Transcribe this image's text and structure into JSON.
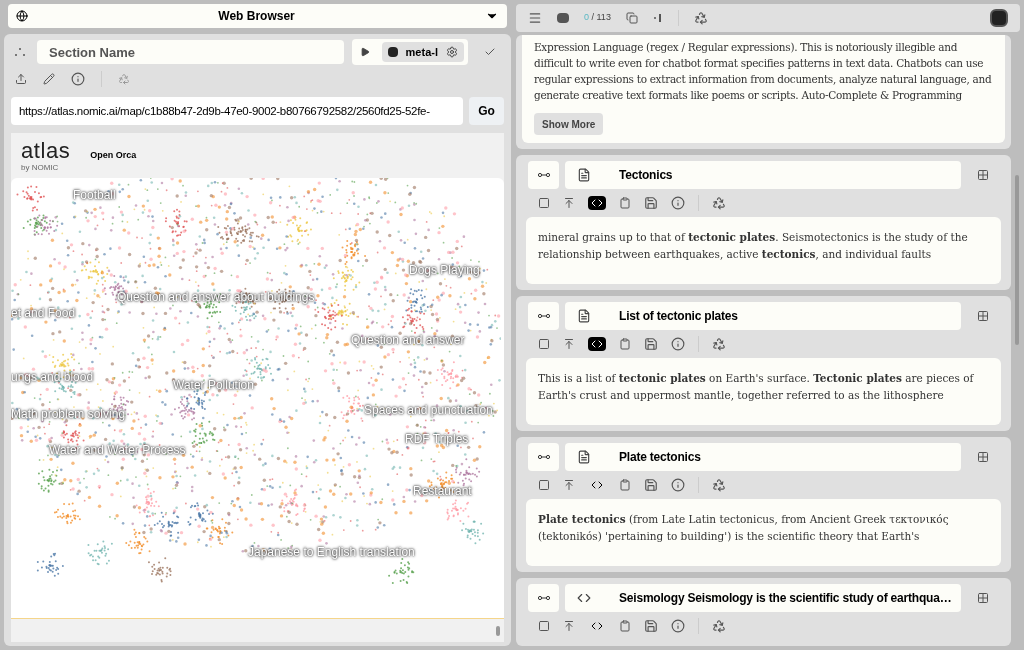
{
  "left_panel": {
    "selector": {
      "title": "Web Browser"
    },
    "section": {
      "placeholder": "Section Name"
    },
    "model": {
      "name": "meta-l"
    },
    "url": {
      "value": "https://atlas.nomic.ai/map/c1b88b47-2d9b-47e0-9002-b80766792582/2560fd25-52fe-"
    },
    "go_button": "Go",
    "atlas": {
      "logo": "atlas",
      "byline": "by NOMIC",
      "project": "Open Orca",
      "labels": [
        "Football",
        "Dogs Playing",
        "Question and answer about buildings",
        "et and Food",
        "Question and answer",
        "ungs and blood",
        "Water Pollution",
        "Math problem solving",
        "Spaces and punctuation",
        "RDF Triples",
        "Water and Water Process",
        "Restaurant",
        "Japanese to English translation"
      ]
    }
  },
  "right_panel": {
    "counter": {
      "current": "0",
      "total": "/ 113"
    },
    "intro_card": {
      "text": "Expression Language (regex / Regular expressions). This is notoriously illegible and difficult to write even for chatbot format specifies patterns in text data. Chatbots can use regular expressions to extract information from documents, analyze natural language, and generate creative text formats like poems or scripts. Auto-Complete & Programming",
      "button": "Show More"
    },
    "cards": [
      {
        "title": "Tectonics",
        "kind": "document",
        "code_view": true,
        "text": "mineral grains up to that of **tectonic plates**. Seismotectonics is the study of the relationship between earthquakes, active **tectonics**, and individual faults"
      },
      {
        "title": "List of tectonic plates",
        "kind": "document",
        "code_view": true,
        "text": "This is a list of **tectonic plates** on Earth's surface. **Tectonic plates** are pieces of Earth's crust and uppermost mantle, together referred to as the lithosphere"
      },
      {
        "title": "Plate tectonics",
        "kind": "document",
        "code_view": false,
        "text": "**Plate tectonics** (from Late Latin tectonicus, from Ancient Greek τεκτονικός (tektonikós) 'pertaining to building') is the scientific theory that Earth's"
      },
      {
        "title": "Seismology Seismology is the scientific study of earthqua…",
        "kind": "code",
        "code_view": false
      }
    ]
  }
}
